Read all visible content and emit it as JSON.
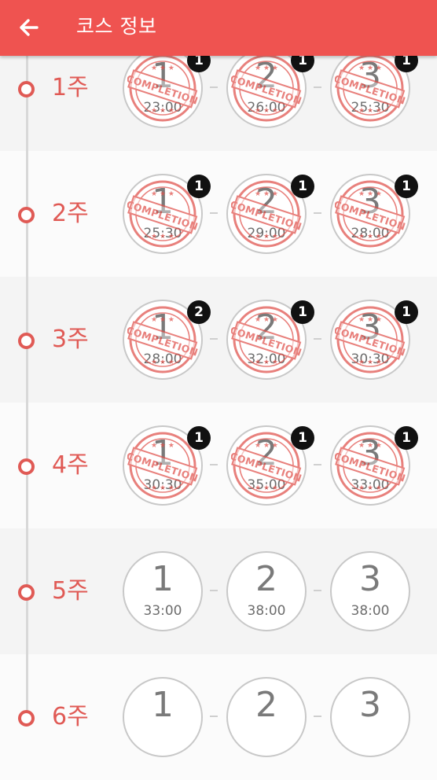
{
  "appbar": {
    "title": "코스 정보",
    "back_icon": "arrow-left-icon",
    "color": "#ef5350"
  },
  "stamp_text": "COMPLETION",
  "weeks": [
    {
      "label": "1주",
      "sessions": [
        {
          "num": "1",
          "time": "23:00",
          "completed": true,
          "badge": "1"
        },
        {
          "num": "2",
          "time": "26:00",
          "completed": true,
          "badge": "1"
        },
        {
          "num": "3",
          "time": "25:30",
          "completed": true,
          "badge": "1"
        }
      ]
    },
    {
      "label": "2주",
      "sessions": [
        {
          "num": "1",
          "time": "25:30",
          "completed": true,
          "badge": "1"
        },
        {
          "num": "2",
          "time": "29:00",
          "completed": true,
          "badge": "1"
        },
        {
          "num": "3",
          "time": "28:00",
          "completed": true,
          "badge": "1"
        }
      ]
    },
    {
      "label": "3주",
      "sessions": [
        {
          "num": "1",
          "time": "28:00",
          "completed": true,
          "badge": "2"
        },
        {
          "num": "2",
          "time": "32:00",
          "completed": true,
          "badge": "1"
        },
        {
          "num": "3",
          "time": "30:30",
          "completed": true,
          "badge": "1"
        }
      ]
    },
    {
      "label": "4주",
      "sessions": [
        {
          "num": "1",
          "time": "30:30",
          "completed": true,
          "badge": "1"
        },
        {
          "num": "2",
          "time": "35:00",
          "completed": true,
          "badge": "1"
        },
        {
          "num": "3",
          "time": "33:00",
          "completed": true,
          "badge": "1"
        }
      ]
    },
    {
      "label": "5주",
      "sessions": [
        {
          "num": "1",
          "time": "33:00",
          "completed": false
        },
        {
          "num": "2",
          "time": "38:00",
          "completed": false
        },
        {
          "num": "3",
          "time": "38:00",
          "completed": false
        }
      ]
    },
    {
      "label": "6주",
      "sessions": [
        {
          "num": "1",
          "completed": false
        },
        {
          "num": "2",
          "completed": false
        },
        {
          "num": "3",
          "completed": false
        }
      ]
    }
  ]
}
